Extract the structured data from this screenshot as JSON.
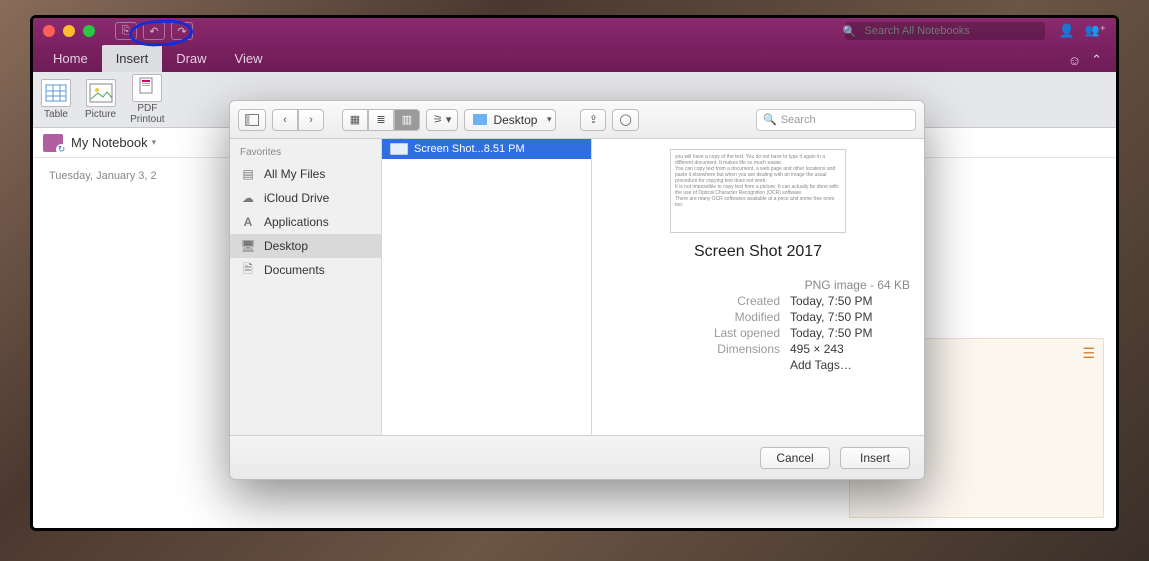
{
  "titlebar": {
    "search_placeholder": "Search All Notebooks"
  },
  "tabs": {
    "items": [
      "Home",
      "Insert",
      "Draw",
      "View"
    ],
    "active_index": 1,
    "smile": "☺",
    "share": "⌃"
  },
  "ribbon": {
    "table": "Table",
    "picture": "Picture",
    "pdf": "PDF\nPrintout"
  },
  "notebook": {
    "name": "My Notebook",
    "chevron": "▾"
  },
  "page": {
    "date": "Tuesday, January 3, 2"
  },
  "dialog": {
    "location": "Desktop",
    "search_placeholder": "Search",
    "favorites_label": "Favorites",
    "favorites": [
      {
        "icon": "all",
        "label": "All My Files"
      },
      {
        "icon": "cloud",
        "label": "iCloud Drive"
      },
      {
        "icon": "apps",
        "label": "Applications"
      },
      {
        "icon": "desktop",
        "label": "Desktop"
      },
      {
        "icon": "docs",
        "label": "Documents"
      }
    ],
    "selected_fav_index": 3,
    "files": [
      {
        "name": "Screen Shot...8.51 PM"
      }
    ],
    "preview": {
      "title": "Screen Shot 2017",
      "kind": "PNG image - 64 KB",
      "created_label": "Created",
      "created": "Today, 7:50 PM",
      "modified_label": "Modified",
      "modified": "Today, 7:50 PM",
      "opened_label": "Last opened",
      "opened": "Today, 7:50 PM",
      "dims_label": "Dimensions",
      "dims": "495 × 243",
      "tags": "Add Tags…"
    },
    "cancel": "Cancel",
    "insert": "Insert"
  }
}
